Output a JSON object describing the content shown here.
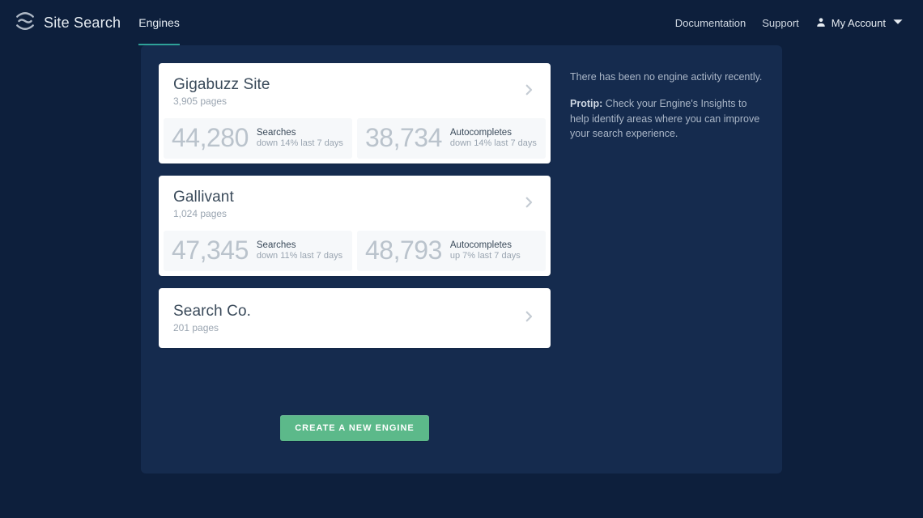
{
  "header": {
    "app_title": "Site Search",
    "nav": {
      "engines": "Engines"
    },
    "links": {
      "documentation": "Documentation",
      "support": "Support"
    },
    "account_label": "My Account"
  },
  "engines": [
    {
      "name": "Gigabuzz Site",
      "pages": "3,905 pages",
      "searches_num": "44,280",
      "searches_title": "Searches",
      "searches_sub": "down 14% last 7 days",
      "auto_num": "38,734",
      "auto_title": "Autocompletes",
      "auto_sub": "down 14% last 7 days",
      "has_stats": true
    },
    {
      "name": "Gallivant",
      "pages": "1,024 pages",
      "searches_num": "47,345",
      "searches_title": "Searches",
      "searches_sub": "down 11% last 7 days",
      "auto_num": "48,793",
      "auto_title": "Autocompletes",
      "auto_sub": "up 7% last 7 days",
      "has_stats": true
    },
    {
      "name": "Search Co.",
      "pages": "201 pages",
      "has_stats": false
    }
  ],
  "sidebar": {
    "no_activity": "There has been no engine activity recently.",
    "protip_label": "Protip:",
    "protip_text": " Check your Engine's Insights to help identify areas where you can improve your search experience."
  },
  "create_button": "Create a new engine"
}
